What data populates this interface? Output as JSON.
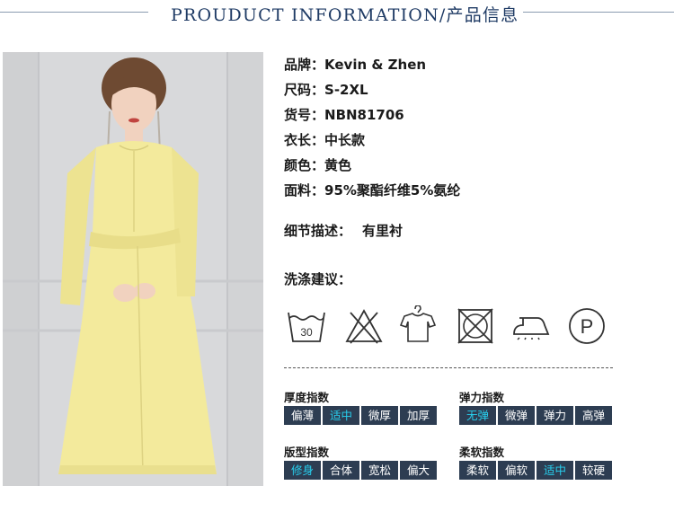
{
  "header": {
    "title": "PROUDUCT INFORMATION/产品信息"
  },
  "product": {
    "brand": {
      "label": "品牌：",
      "value": "Kevin & Zhen"
    },
    "size": {
      "label": "尺码：",
      "value": "S-2XL"
    },
    "item_no": {
      "label": "货号：",
      "value": "NBN81706"
    },
    "length": {
      "label": "衣长：",
      "value": "中长款"
    },
    "color": {
      "label": "颜色：",
      "value": "黄色"
    },
    "fabric": {
      "label": "面料：",
      "value": "95%聚酯纤维5%氨纶"
    },
    "detail": {
      "label": "细节描述：",
      "value": "有里衬"
    },
    "wash_title": "洗涤建议："
  },
  "care_icons": [
    {
      "name": "wash-30-icon",
      "text": "30"
    },
    {
      "name": "no-bleach-icon"
    },
    {
      "name": "hang-dry-icon"
    },
    {
      "name": "no-tumble-dry-icon"
    },
    {
      "name": "iron-low-icon"
    },
    {
      "name": "dry-clean-p-icon",
      "text": "P"
    }
  ],
  "indices": {
    "thickness": {
      "label": "厚度指数",
      "options": [
        "偏薄",
        "适中",
        "微厚",
        "加厚"
      ],
      "selected": 1
    },
    "elasticity": {
      "label": "弹力指数",
      "options": [
        "无弹",
        "微弹",
        "弹力",
        "高弹"
      ],
      "selected": 0
    },
    "fit": {
      "label": "版型指数",
      "options": [
        "修身",
        "合体",
        "宽松",
        "偏大"
      ],
      "selected": 0
    },
    "softness": {
      "label": "柔软指数",
      "options": [
        "柔软",
        "偏软",
        "适中",
        "较硬"
      ],
      "selected": 2
    }
  },
  "colors": {
    "index_bg": "#2d3d52",
    "selected_text": "#28d0ef",
    "header_text": "#1e3a64",
    "dress": "#f3ea9c"
  }
}
